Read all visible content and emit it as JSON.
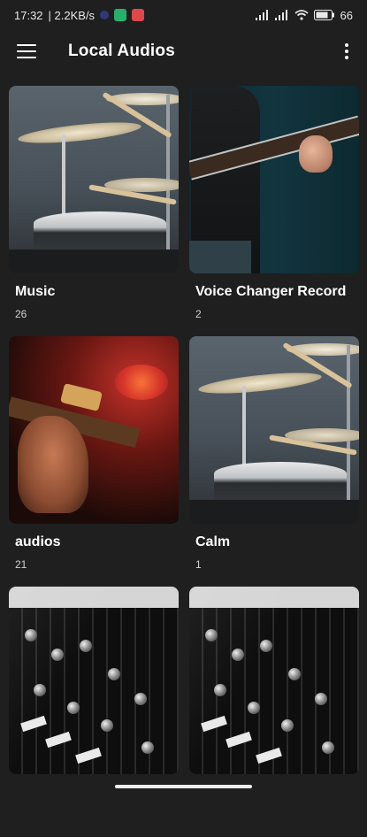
{
  "status_bar": {
    "time": "17:32",
    "network_speed": "| 2.2KB/s",
    "battery_percent": "66",
    "icons": [
      "notification-app-icon-blue",
      "notification-app-icon-green",
      "notification-app-icon-red",
      "signal-icon",
      "signal-icon",
      "wifi-icon",
      "battery-icon"
    ]
  },
  "app_bar": {
    "title": "Local Audios",
    "left_icon": "menu-icon",
    "right_icon": "more-vert-icon"
  },
  "albums": [
    {
      "title": "Music",
      "count": "26",
      "thumbnail": "drums"
    },
    {
      "title": "Voice Changer Record",
      "count": "2",
      "thumbnail": "guitar-player"
    },
    {
      "title": "audios",
      "count": "21",
      "thumbnail": "red-guitar"
    },
    {
      "title": "Calm",
      "count": "1",
      "thumbnail": "drums"
    },
    {
      "title": "",
      "count": "",
      "thumbnail": "mixer"
    },
    {
      "title": "",
      "count": "",
      "thumbnail": "mixer"
    }
  ],
  "colors": {
    "background": "#1f1f1f",
    "text_primary": "#ffffff",
    "text_secondary": "#d0d0d0"
  }
}
